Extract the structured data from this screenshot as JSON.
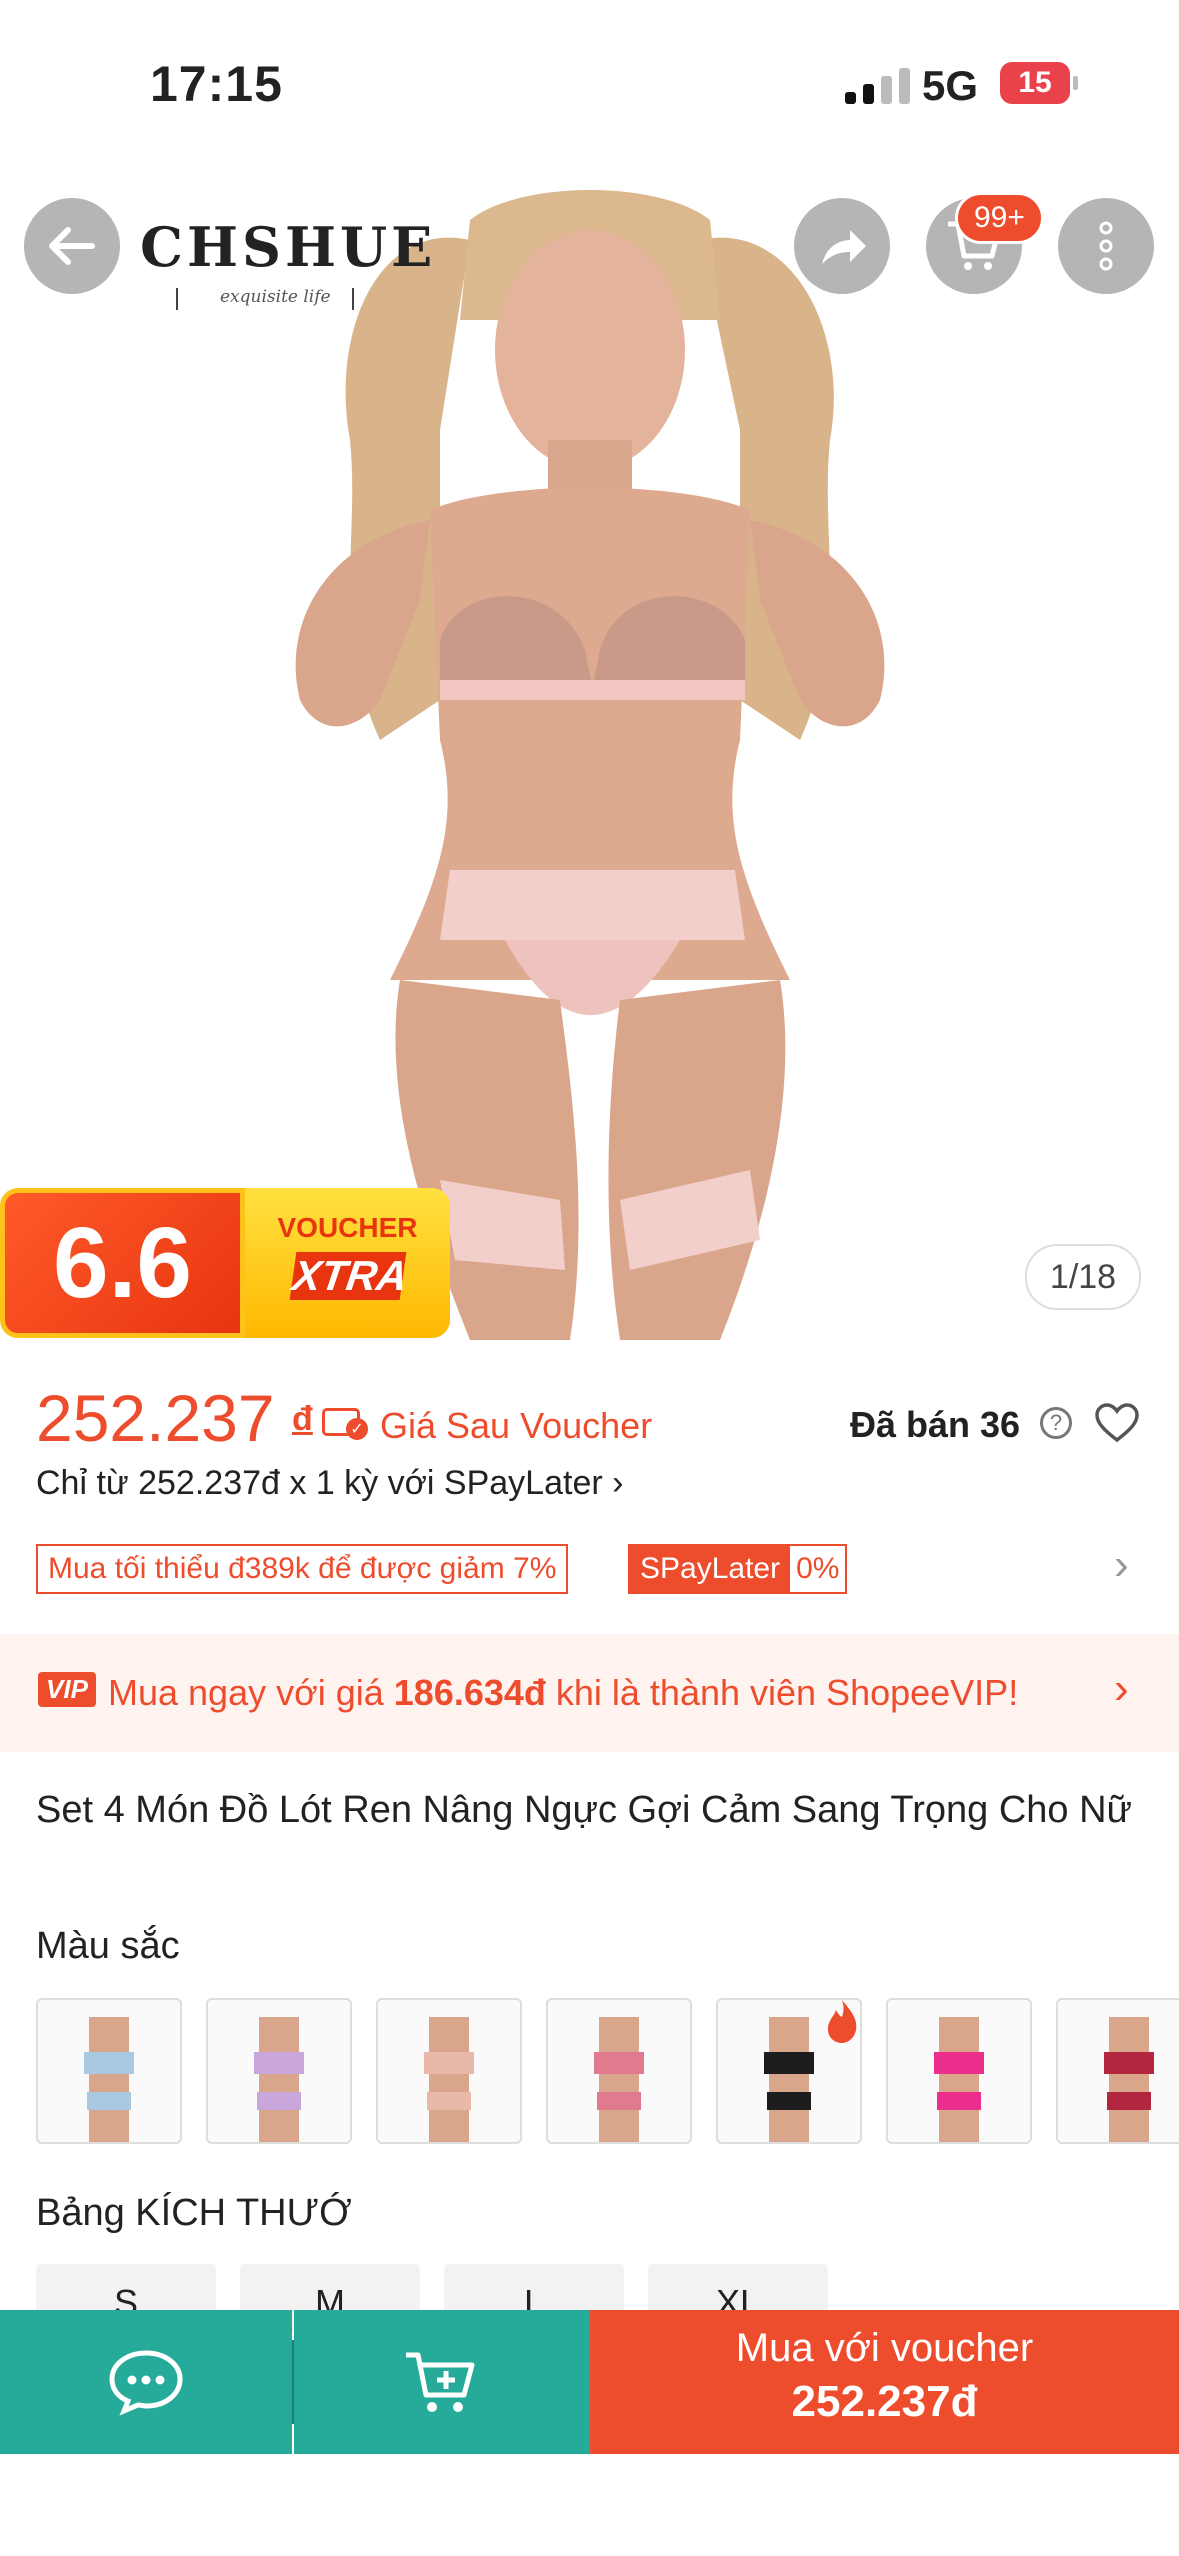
{
  "status": {
    "time": "17:15",
    "network": "5G",
    "battery": "15"
  },
  "header": {
    "brand": "CHSHUE",
    "brand_tagline": "exquisite life",
    "cart_badge": "99+"
  },
  "gallery": {
    "counter": "1/18",
    "promo_number": "6.6",
    "promo_voucher": "VOUCHER",
    "promo_xtra": "XTRA"
  },
  "price": {
    "amount": "252.237",
    "currency": "đ",
    "after_voucher_label": "Giá Sau Voucher",
    "sold": "Đã bán 36",
    "spaylater": "Chỉ từ 252.237đ x 1 kỳ với SPayLater ›",
    "min_order_tag": "Mua tối thiểu đ389k để được giảm 7%",
    "spay_tag": "SPayLater",
    "spay_rate": "0%"
  },
  "vip": {
    "badge": "VIP",
    "text_pre": "Mua ngay với giá ",
    "price": "186.634đ",
    "text_post": " khi là thành viên ShopeeVIP!"
  },
  "product": {
    "title": "Set 4 Món Đồ Lót Ren Nâng Ngực Gợi Cảm Sang Trọng Cho Nữ",
    "color_label": "Màu sắc",
    "size_label": "Bảng KÍCH THƯỚ",
    "sizes": [
      "S",
      "M",
      "L",
      "XL"
    ],
    "colors": [
      {
        "name": "light-blue",
        "hex": "#a9c9e3"
      },
      {
        "name": "lavender",
        "hex": "#c9a6dc"
      },
      {
        "name": "nude-pink",
        "hex": "#e8b9a8"
      },
      {
        "name": "pink-multi",
        "hex": "#e07a8f"
      },
      {
        "name": "black",
        "hex": "#1d1d1d"
      },
      {
        "name": "hot-pink",
        "hex": "#ec2f8c"
      },
      {
        "name": "wine-red",
        "hex": "#b3263f"
      }
    ]
  },
  "bottom_bar": {
    "buy_label": "Mua với voucher",
    "buy_price": "252.237đ"
  },
  "colors": {
    "accent": "#ee4d2d",
    "teal": "#26aa99"
  }
}
